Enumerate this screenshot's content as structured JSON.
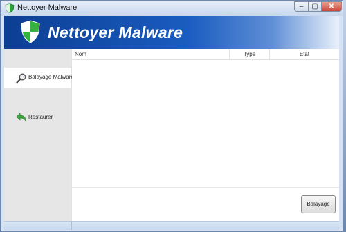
{
  "window": {
    "title": "Nettoyer Malware",
    "controls": {
      "minimize": "–",
      "maximize": "▢",
      "close": "✕"
    }
  },
  "banner": {
    "title": "Nettoyer Malware"
  },
  "sidebar": {
    "items": [
      {
        "label": "Balayage Malware",
        "icon": "magnifier-icon",
        "selected": true
      },
      {
        "label": "Restaurer",
        "icon": "restore-arrow-icon",
        "selected": false
      }
    ]
  },
  "table": {
    "columns": [
      "Nom",
      "Type",
      "Etat"
    ],
    "rows": []
  },
  "actions": {
    "scan_button": "Balayage"
  },
  "colors": {
    "banner_dark": "#0c3e92",
    "banner_light": "#5f8fd6",
    "shield_green": "#2fa33a"
  }
}
